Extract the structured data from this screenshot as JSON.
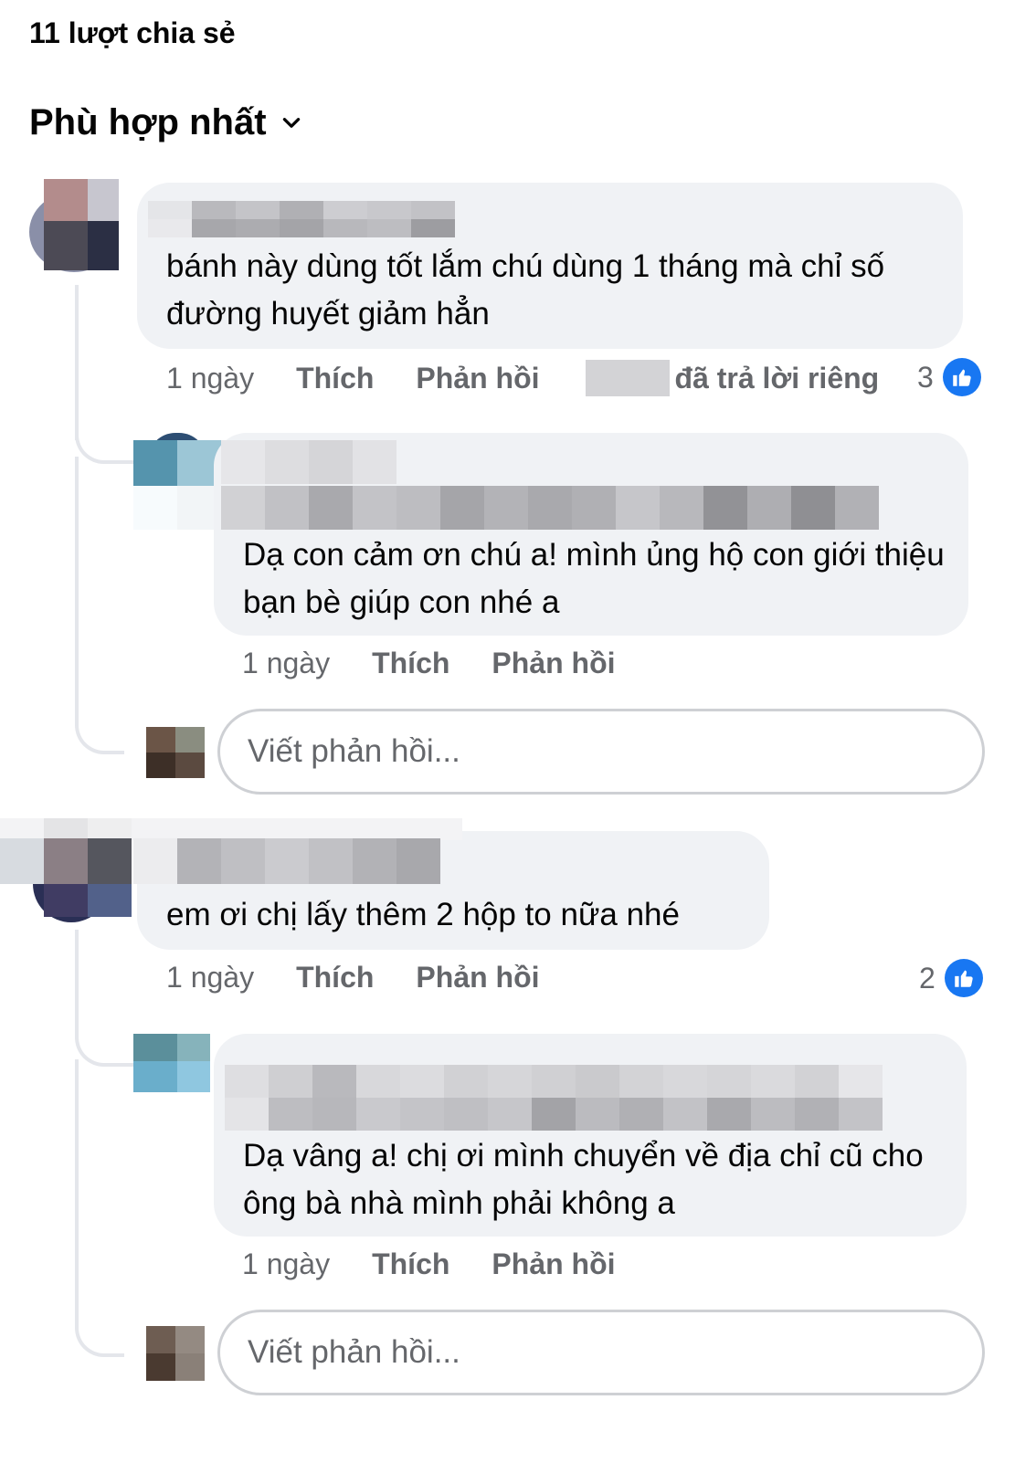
{
  "header": {
    "share_count": "11 lượt chia sẻ"
  },
  "sort": {
    "label": "Phù hợp nhất",
    "icon": "chevron-down-icon"
  },
  "comments": [
    {
      "text": "bánh này dùng tốt lắm chú dùng 1 tháng mà chỉ số đường huyết giảm hẳn",
      "time": "1 ngày",
      "like_label": "Thích",
      "reply_label": "Phản hồi",
      "private_reply": "đã trả lời riêng",
      "reaction_count": "3",
      "reply": {
        "text": "Dạ con cảm ơn chú a! mình ủng hộ con giới thiệu bạn bè giúp con nhé a",
        "time": "1 ngày",
        "like_label": "Thích",
        "reply_label": "Phản hồi"
      },
      "reply_input_placeholder": "Viết phản hồi..."
    },
    {
      "text": "em ơi chị lấy thêm 2 hộp to nữa nhé",
      "time": "1 ngày",
      "like_label": "Thích",
      "reply_label": "Phản hồi",
      "reaction_count": "2",
      "reply": {
        "text": "Dạ vâng a! chị ơi mình chuyển về địa chỉ cũ cho ông bà nhà mình phải không a",
        "time": "1 ngày",
        "like_label": "Thích",
        "reply_label": "Phản hồi"
      },
      "reply_input_placeholder": "Viết phản hồi..."
    }
  ],
  "colors": {
    "bubble": "#f0f2f5",
    "like_blue": "#1877f2",
    "muted": "#65676b"
  }
}
